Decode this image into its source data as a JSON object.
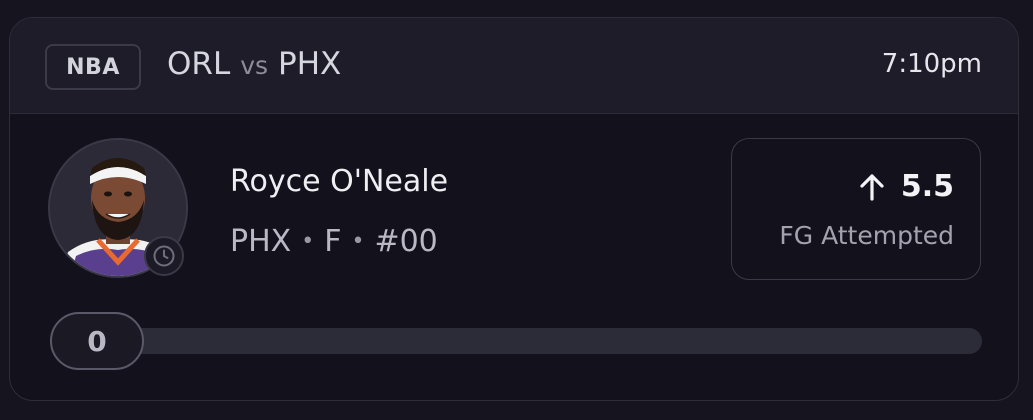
{
  "game": {
    "league": "NBA",
    "away_team": "ORL",
    "vs_label": "vs",
    "home_team": "PHX",
    "time": "7:10pm"
  },
  "player": {
    "name": "Royce O'Neale",
    "team": "PHX",
    "separator": "•",
    "position": "F",
    "number": "#00",
    "avatar_icon": "player-headshot",
    "status_icon": "clock-icon"
  },
  "prop": {
    "direction_icon": "arrow-up-icon",
    "line": "5.5",
    "stat": "FG Attempted"
  },
  "progress": {
    "current": "0",
    "fraction": 0
  },
  "colors": {
    "background": "#15141f",
    "header": "#1d1c28",
    "border": "#3a3947"
  }
}
